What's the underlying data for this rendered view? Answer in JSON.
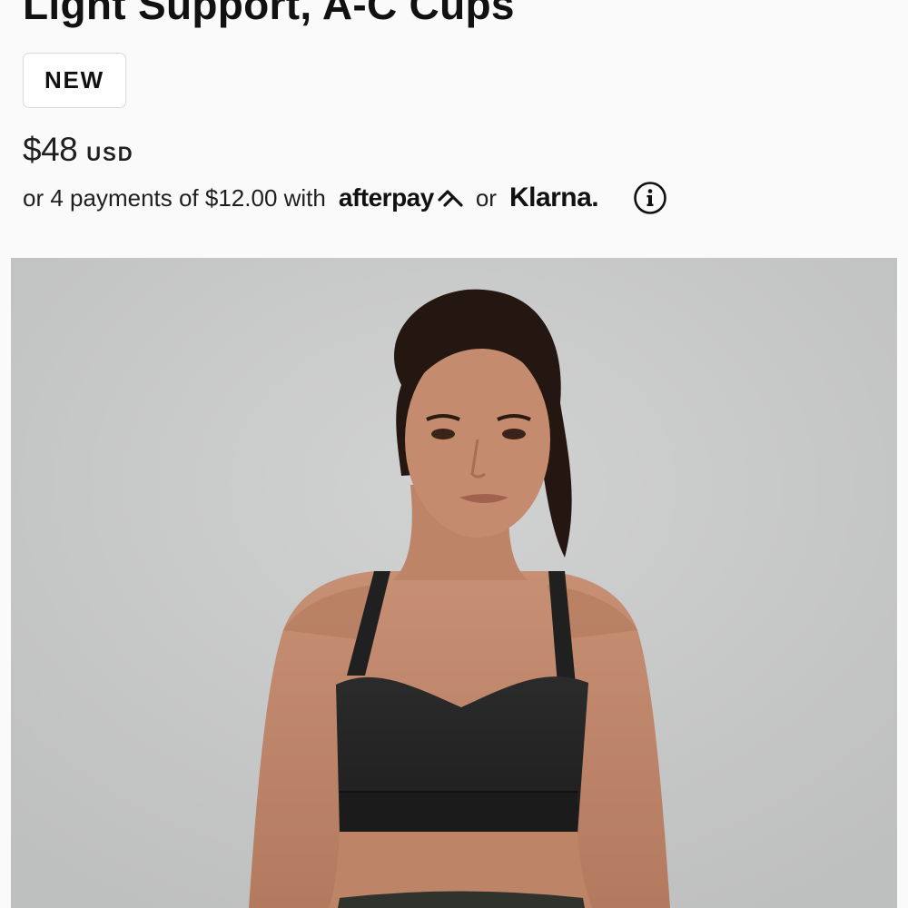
{
  "product": {
    "title": "Light Support, A-C Cups",
    "badge": "NEW",
    "price": "$48",
    "currency": "USD"
  },
  "payments": {
    "text": "or 4 payments of $12.00 with",
    "afterpay_label": "afterpay",
    "or_label": "or",
    "klarna_label": "Klarna.",
    "info_icon": "info-circle-icon"
  },
  "image": {
    "icon": "product-photo",
    "background_color": "#c7c8c8"
  }
}
